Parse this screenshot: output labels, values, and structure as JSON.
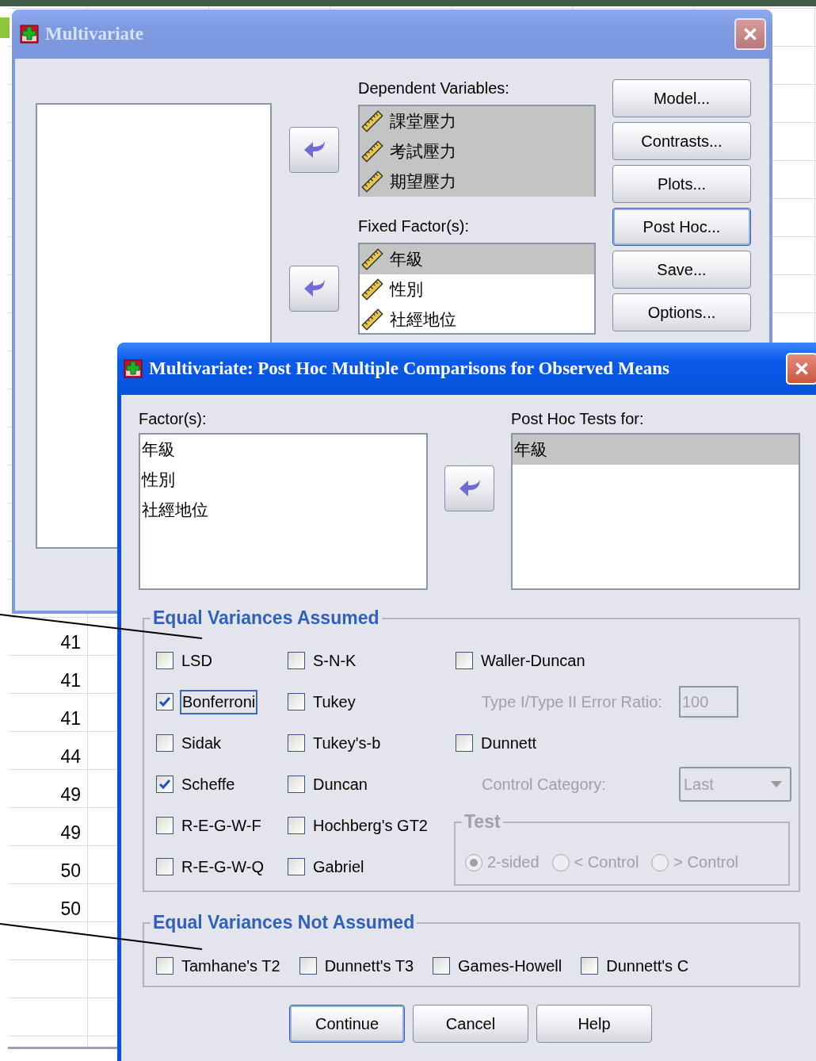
{
  "sheet": {
    "cells": [
      "41",
      "41",
      "41",
      "44",
      "49",
      "49",
      "50",
      "50"
    ]
  },
  "main_window": {
    "title": "Multivariate",
    "active": false,
    "dependent_variables": {
      "label": "Dependent Variables:",
      "items": [
        {
          "text": "課堂壓力",
          "selected": true
        },
        {
          "text": "考試壓力",
          "selected": true
        },
        {
          "text": "期望壓力",
          "selected": true
        }
      ]
    },
    "fixed_factors": {
      "label": "Fixed Factor(s):",
      "items": [
        {
          "text": "年級",
          "selected": true
        },
        {
          "text": "性別",
          "selected": false
        },
        {
          "text": "社經地位",
          "selected": false
        }
      ]
    },
    "buttons": [
      {
        "label": "Model...",
        "focused": false
      },
      {
        "label": "Contrasts...",
        "focused": false
      },
      {
        "label": "Plots...",
        "focused": false
      },
      {
        "label": "Post Hoc...",
        "focused": true
      },
      {
        "label": "Save...",
        "focused": false
      },
      {
        "label": "Options...",
        "focused": false
      }
    ]
  },
  "post_hoc_dialog": {
    "title": "Multivariate: Post Hoc Multiple Comparisons for Observed Means",
    "active": true,
    "factors": {
      "label": "Factor(s):",
      "items": [
        {
          "text": "年級",
          "selected": false
        },
        {
          "text": "性別",
          "selected": false
        },
        {
          "text": "社經地位",
          "selected": false
        }
      ]
    },
    "post_hoc_tests_for": {
      "label": "Post Hoc Tests for:",
      "items": [
        {
          "text": "年級",
          "selected": true
        }
      ]
    },
    "equal_variances_assumed": {
      "title": "Equal Variances Assumed",
      "column_1": [
        {
          "label": "LSD",
          "checked": false,
          "focused": false
        },
        {
          "label": "Bonferroni",
          "checked": true,
          "focused": true
        },
        {
          "label": "Sidak",
          "checked": false,
          "focused": false
        },
        {
          "label": "Scheffe",
          "checked": true,
          "focused": false
        },
        {
          "label": "R-E-G-W-F",
          "checked": false,
          "focused": false
        },
        {
          "label": "R-E-G-W-Q",
          "checked": false,
          "focused": false
        }
      ],
      "column_2": [
        {
          "label": "S-N-K",
          "checked": false,
          "focused": false
        },
        {
          "label": "Tukey",
          "checked": false,
          "focused": false
        },
        {
          "label": "Tukey's-b",
          "checked": false,
          "focused": false
        },
        {
          "label": "Duncan",
          "checked": false,
          "focused": false
        },
        {
          "label": "Hochberg's GT2",
          "checked": false,
          "focused": false
        },
        {
          "label": "Gabriel",
          "checked": false,
          "focused": false
        }
      ],
      "waller_duncan": {
        "label": "Waller-Duncan",
        "checked": false,
        "focused": false
      },
      "error_ratio": {
        "label": "Type I/Type II Error Ratio:",
        "value": "100",
        "disabled": true
      },
      "dunnett": {
        "label": "Dunnett",
        "checked": false,
        "focused": false
      },
      "control_category": {
        "label": "Control Category:",
        "value": "Last",
        "disabled": true
      },
      "test": {
        "title": "Test",
        "disabled": true,
        "options": [
          {
            "label": "2-sided",
            "selected": true
          },
          {
            "label": "< Control",
            "selected": false
          },
          {
            "label": "> Control",
            "selected": false
          }
        ]
      }
    },
    "equal_variances_not_assumed": {
      "title": "Equal Variances Not Assumed",
      "checkboxes": [
        {
          "label": "Tamhane's T2",
          "checked": false,
          "focused": false
        },
        {
          "label": "Dunnett's T3",
          "checked": false,
          "focused": false
        },
        {
          "label": "Games-Howell",
          "checked": false,
          "focused": false
        },
        {
          "label": "Dunnett's C",
          "checked": false,
          "focused": false
        }
      ]
    },
    "buttons": [
      {
        "label": "Continue",
        "focused": true
      },
      {
        "label": "Cancel",
        "focused": false
      },
      {
        "label": "Help",
        "focused": false
      }
    ]
  }
}
